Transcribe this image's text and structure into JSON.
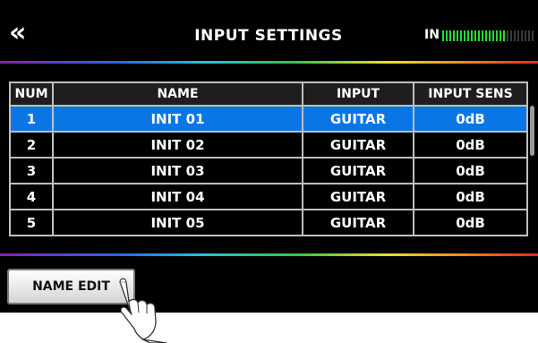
{
  "header": {
    "back_glyph": "«",
    "title": "INPUT SETTINGS",
    "level_label": "IN",
    "input_level": 0.7
  },
  "table": {
    "columns": [
      "NUM",
      "NAME",
      "INPUT",
      "INPUT SENS"
    ],
    "rows": [
      {
        "num": "1",
        "name": "INIT 01",
        "input": "GUITAR",
        "sens": "0dB"
      },
      {
        "num": "2",
        "name": "INIT 02",
        "input": "GUITAR",
        "sens": "0dB"
      },
      {
        "num": "3",
        "name": "INIT 03",
        "input": "GUITAR",
        "sens": "0dB"
      },
      {
        "num": "4",
        "name": "INIT 04",
        "input": "GUITAR",
        "sens": "0dB"
      },
      {
        "num": "5",
        "name": "INIT 05",
        "input": "GUITAR",
        "sens": "0dB"
      }
    ],
    "selected_row": 1
  },
  "footer": {
    "name_edit_label": "NAME EDIT"
  },
  "colors": {
    "selection": "#0a76e6",
    "meter_on": "#22dd33",
    "background": "#000000"
  },
  "icons": {
    "back": "double-chevron-left-icon",
    "pointer": "pointing-hand-icon"
  }
}
